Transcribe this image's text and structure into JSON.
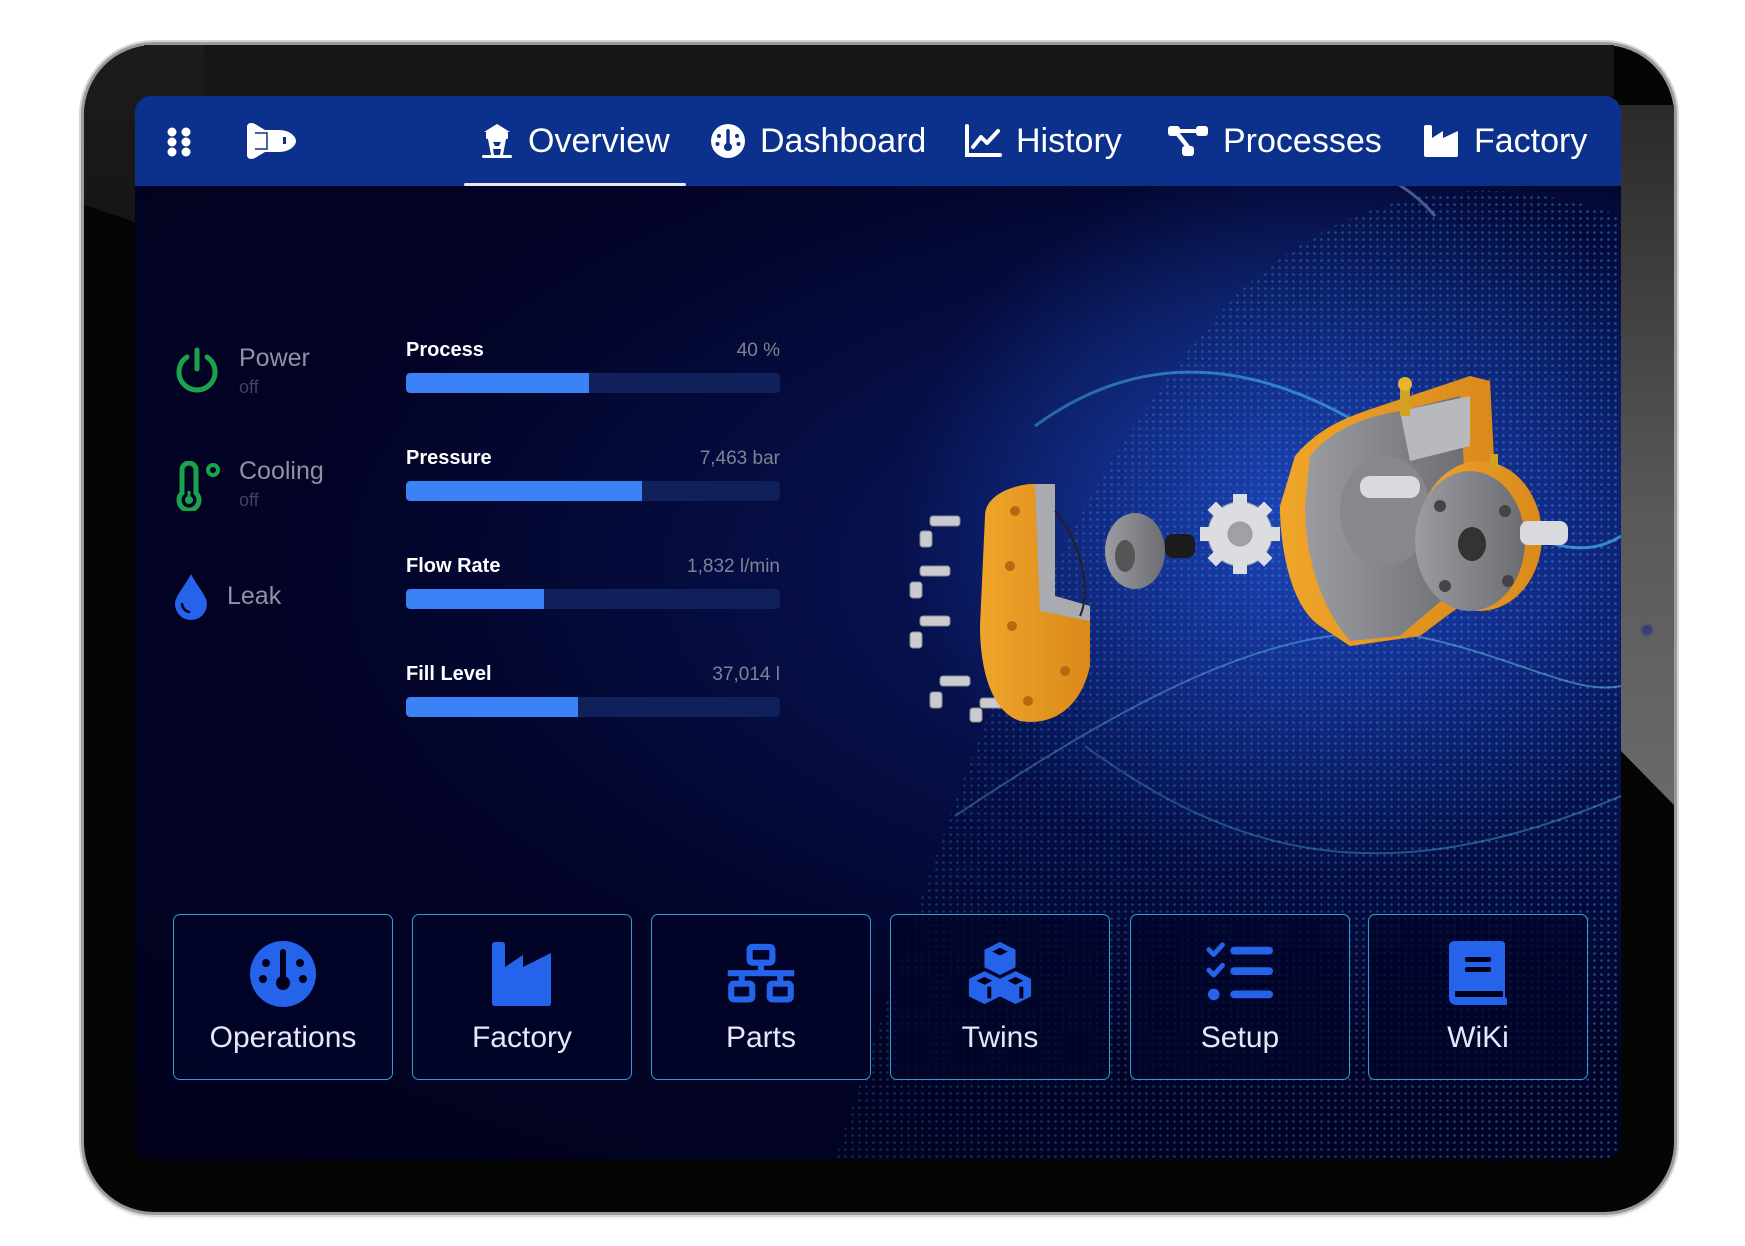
{
  "theme": {
    "header_bg": "#0c318c",
    "accent_blue": "#3b82f6",
    "icon_blue": "#2563eb",
    "status_green": "#1aa34a",
    "tile_border": "#2a9fd6",
    "screen_bg": "#01011d"
  },
  "header": {
    "menu_icon": "grid-icon",
    "logo_icon": "spaceship-logo-icon",
    "tabs": [
      {
        "label": "Overview",
        "icon": "watchtower-icon",
        "active": true
      },
      {
        "label": "Dashboard",
        "icon": "gauge-icon",
        "active": false
      },
      {
        "label": "History",
        "icon": "line-chart-icon",
        "active": false
      },
      {
        "label": "Processes",
        "icon": "process-nodes-icon",
        "active": false
      },
      {
        "label": "Factory",
        "icon": "factory-icon",
        "active": false
      }
    ]
  },
  "status": [
    {
      "title": "Power",
      "state": "off",
      "icon": "power-icon"
    },
    {
      "title": "Cooling",
      "state": "off",
      "icon": "thermometer-celsius-icon"
    },
    {
      "title": "Leak",
      "state": "",
      "icon": "droplet-icon"
    }
  ],
  "metrics": [
    {
      "label": "Process",
      "value": "40 %",
      "fill_fraction": 0.49
    },
    {
      "label": "Pressure",
      "value": "7,463 bar",
      "fill_fraction": 0.63
    },
    {
      "label": "Flow Rate",
      "value": "1,832 l/min",
      "fill_fraction": 0.37
    },
    {
      "label": "Fill Level",
      "value": "37,014 l",
      "fill_fraction": 0.46
    }
  ],
  "hero": {
    "image": "exploded gear pump render over particle wave background"
  },
  "tiles": [
    {
      "label": "Operations",
      "icon": "gauge-icon"
    },
    {
      "label": "Factory",
      "icon": "factory-icon"
    },
    {
      "label": "Parts",
      "icon": "network-hierarchy-icon"
    },
    {
      "label": "Twins",
      "icon": "cubes-icon"
    },
    {
      "label": "Setup",
      "icon": "checklist-icon"
    },
    {
      "label": "WiKi",
      "icon": "book-icon"
    }
  ]
}
